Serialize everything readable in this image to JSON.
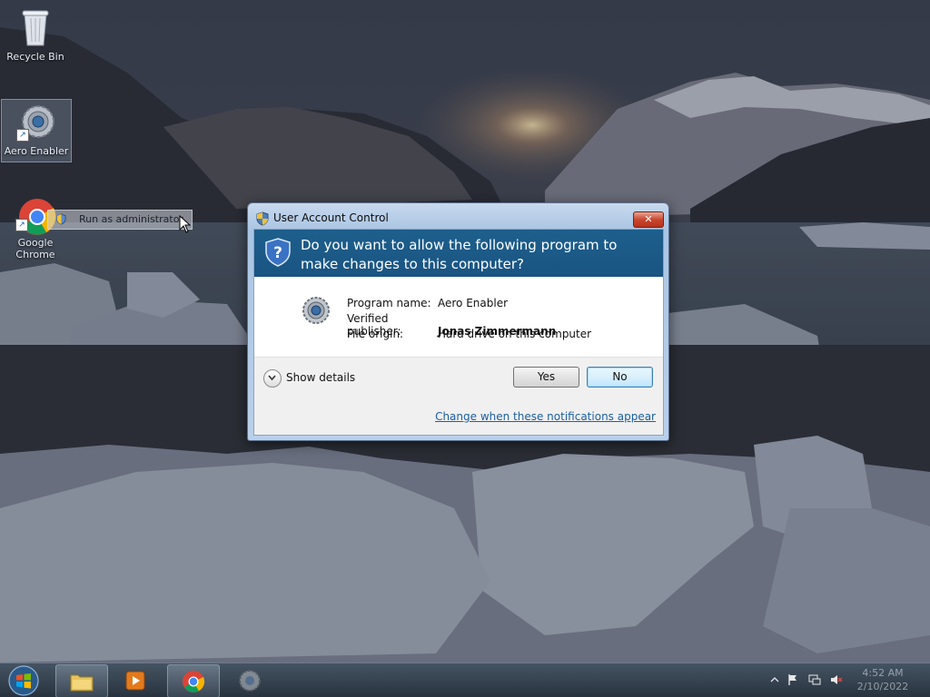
{
  "desktop": {
    "icons": [
      {
        "label": "Recycle Bin"
      },
      {
        "label": "Aero Enabler"
      },
      {
        "label": "Google Chrome"
      }
    ],
    "context_item": "Run as administrator"
  },
  "dialog": {
    "title": "User Account Control",
    "close_glyph": "✕",
    "question": "Do you want to allow the following program to make changes to this computer?",
    "program_icon": "gear-icon",
    "rows": [
      {
        "key": "Program name:",
        "value": "Aero Enabler",
        "bold": false
      },
      {
        "key": "Verified publisher:",
        "value": "Jonas Zimmermann",
        "bold": true
      },
      {
        "key": "File origin:",
        "value": "Hard drive on this computer",
        "bold": false
      }
    ],
    "show_details": "Show details",
    "yes": "Yes",
    "no": "No",
    "change_link": "Change when these notifications appear",
    "colors": {
      "header": "#1d5f8c",
      "link": "#1c5fa3"
    }
  },
  "taskbar": {
    "items": [
      "windows-explorer",
      "media-player",
      "google-chrome",
      "aero-enabler"
    ],
    "clock_time": "4:52 AM",
    "clock_date": "2/10/2022"
  }
}
